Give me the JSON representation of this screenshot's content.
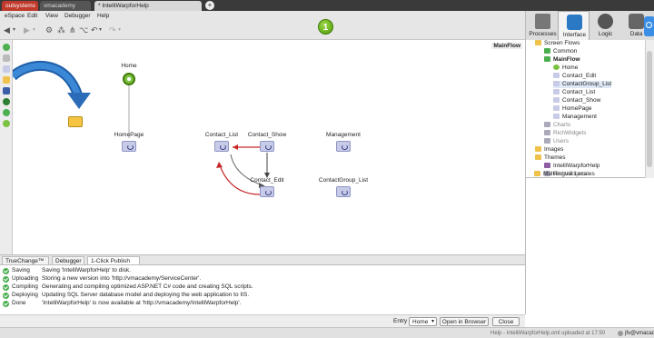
{
  "tabs": [
    {
      "label": "outsystems"
    },
    {
      "label": "vmacademy"
    },
    {
      "label": "* IntelliWarpforHelp"
    }
  ],
  "menu": [
    "eSpace",
    "Edit",
    "View",
    "Debugger",
    "Help"
  ],
  "toolbar": {
    "step_badge": "1"
  },
  "right_tabs": [
    {
      "label": "Processes",
      "icon": "processes-icon"
    },
    {
      "label": "Interface",
      "icon": "interface-icon"
    },
    {
      "label": "Logic",
      "icon": "logic-icon"
    },
    {
      "label": "Data",
      "icon": "data-icon"
    }
  ],
  "canvas": {
    "flow_name": "MainFlow",
    "nodes": [
      "Home",
      "HomePage",
      "Contact_List",
      "Contact_Show",
      "Management",
      "Contact_Edit",
      "ContactGroup_List"
    ]
  },
  "tree": {
    "items": [
      "Screen Flows",
      "Common",
      "MainFlow",
      "Home",
      "Contact_Edit",
      "ContactGroup_List",
      "Contact_List",
      "Contact_Show",
      "HomePage",
      "Management",
      "Charts",
      "RichWidgets",
      "Users",
      "Images",
      "Themes",
      "IntelliWarpforHelp",
      "RichWidgets",
      "Multilingual Locales"
    ]
  },
  "bottom_tabs": [
    "TrueChange™",
    "Debugger",
    "1-Click Publish"
  ],
  "log": [
    {
      "status": "Saving",
      "message": "Saving 'IntelliWarpforHelp' to disk."
    },
    {
      "status": "Uploading",
      "message": "Storing a new version into 'http://vmacademy/ServiceCenter'."
    },
    {
      "status": "Compiling",
      "message": "Generating and compiling optimized ASP.NET C# code and creating SQL scripts."
    },
    {
      "status": "Deploying",
      "message": "Updating SQL Server database model and deploying the web application to IIS."
    },
    {
      "status": "Done",
      "message": "'IntelliWarpforHelp' is now available at 'http://vmacademy/IntelliWarpforHelp'."
    }
  ],
  "entry": {
    "label": "Entry",
    "value": "Home",
    "open_button": "Open in Browser",
    "close_button": "Close"
  },
  "status": {
    "left": "Help - IntelliWarpforHelp.oml uploaded at 17:50",
    "user": "jfv@vmacademy"
  }
}
